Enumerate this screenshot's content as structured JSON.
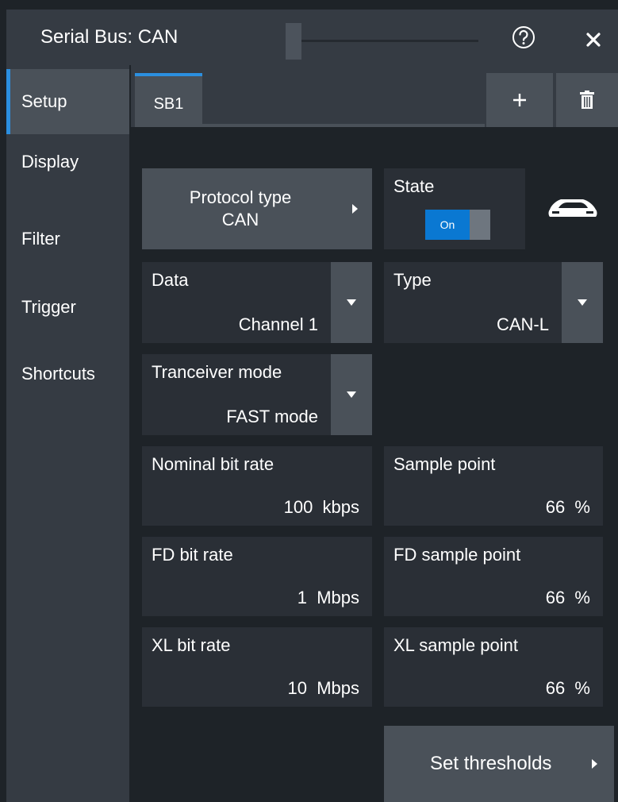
{
  "window": {
    "title": "Serial Bus: CAN",
    "help_icon": "question-circle-icon",
    "close_icon": "close-icon"
  },
  "sidebar": {
    "items": [
      {
        "label": "Setup",
        "active": true
      },
      {
        "label": "Display"
      },
      {
        "label": "Filter"
      },
      {
        "label": "Trigger"
      },
      {
        "label": "Shortcuts"
      }
    ]
  },
  "tabs": {
    "active": "SB1",
    "add_icon": "plus-icon",
    "delete_icon": "trash-icon"
  },
  "setup": {
    "protocol": {
      "label": "Protocol type",
      "value": "CAN"
    },
    "state": {
      "label": "State",
      "value": "On"
    },
    "bus_icon": "car-icon",
    "data": {
      "label": "Data",
      "value": "Channel 1"
    },
    "type": {
      "label": "Type",
      "value": "CAN-L"
    },
    "transceiver": {
      "label": "Tranceiver mode",
      "value": "FAST mode"
    },
    "nominal_bit_rate": {
      "label": "Nominal bit rate",
      "value": "100  kbps"
    },
    "sample_point": {
      "label": "Sample point",
      "value": "66  %"
    },
    "fd_bit_rate": {
      "label": "FD bit rate",
      "value": "1  Mbps"
    },
    "fd_sample_point": {
      "label": "FD sample point",
      "value": "66  %"
    },
    "xl_bit_rate": {
      "label": "XL bit rate",
      "value": "10  Mbps"
    },
    "xl_sample_point": {
      "label": "XL sample point",
      "value": "66  %"
    },
    "set_thresholds": {
      "label": "Set thresholds"
    }
  },
  "colors": {
    "accent": "#2b8fe0",
    "toggle_on": "#0a78d2",
    "panel": "#2a2f36",
    "background": "#1e2328"
  }
}
